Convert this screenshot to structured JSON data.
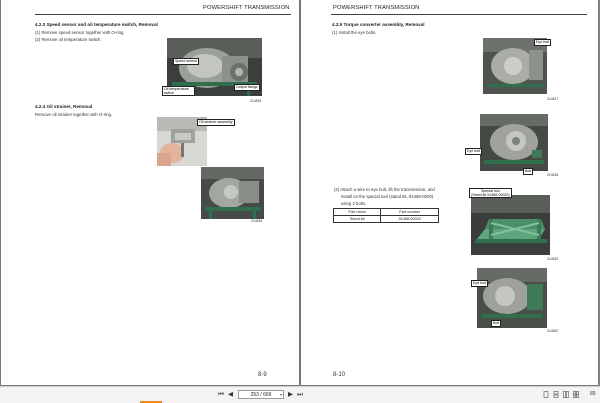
{
  "left_page": {
    "header": "POWERSHIFT TRANSMISSION",
    "sections": [
      {
        "title": "4.2.3   Speed sensor and oil temperature switch, Removal",
        "lines": [
          "(1)  Remove speed sensor together with O-ring.",
          "(2)  Remove oil temperature switch."
        ]
      },
      {
        "title": "4.2.4   Oil strainer, Removal",
        "lines": [
          "Remove oil strainer together with O-ring."
        ]
      }
    ],
    "figures": [
      {
        "callouts": [
          "Speed sensor",
          "Oil temperature switch",
          "Output flange"
        ],
        "id": "214815"
      },
      {
        "callouts": [
          "Oil strainer assembly"
        ],
        "id": "214816"
      }
    ],
    "page_number": "8-9"
  },
  "right_page": {
    "header": "POWERSHIFT TRANSMISSION",
    "section_title": "4.2.5   Torque converter assembly, Removal",
    "step1": "(1)  Install the eye bolts.",
    "step2_lines": [
      "(2)  Attach a wire to eye bolt, lift the transmission, and",
      "install on the special tool (stand kit, 91468-0020)",
      "using 2 bolts."
    ],
    "table": {
      "headers": [
        "Part name",
        "Part number"
      ],
      "rows": [
        [
          "Stand kit",
          "91468-00020"
        ]
      ]
    },
    "figures": [
      {
        "callouts": [
          "Eye bolt"
        ],
        "id": "214817"
      },
      {
        "callouts": [
          "Eye bolt",
          "Bolt"
        ],
        "id": "214818"
      },
      {
        "callouts": [
          "Special tool",
          "(Stand kit 91468-00020)"
        ],
        "id": "214819"
      },
      {
        "callouts": [
          "Eye bolt",
          "Bolt"
        ],
        "id": "214820"
      }
    ],
    "page_number": "8-10"
  },
  "toolbar": {
    "page_indicator": "253 / 669",
    "zoom": "89",
    "icons": [
      "first-page-icon",
      "prev-page-icon",
      "next-page-icon",
      "last-page-icon",
      "single-page-icon",
      "continuous-icon",
      "two-page-icon",
      "facing-pages-icon"
    ]
  }
}
